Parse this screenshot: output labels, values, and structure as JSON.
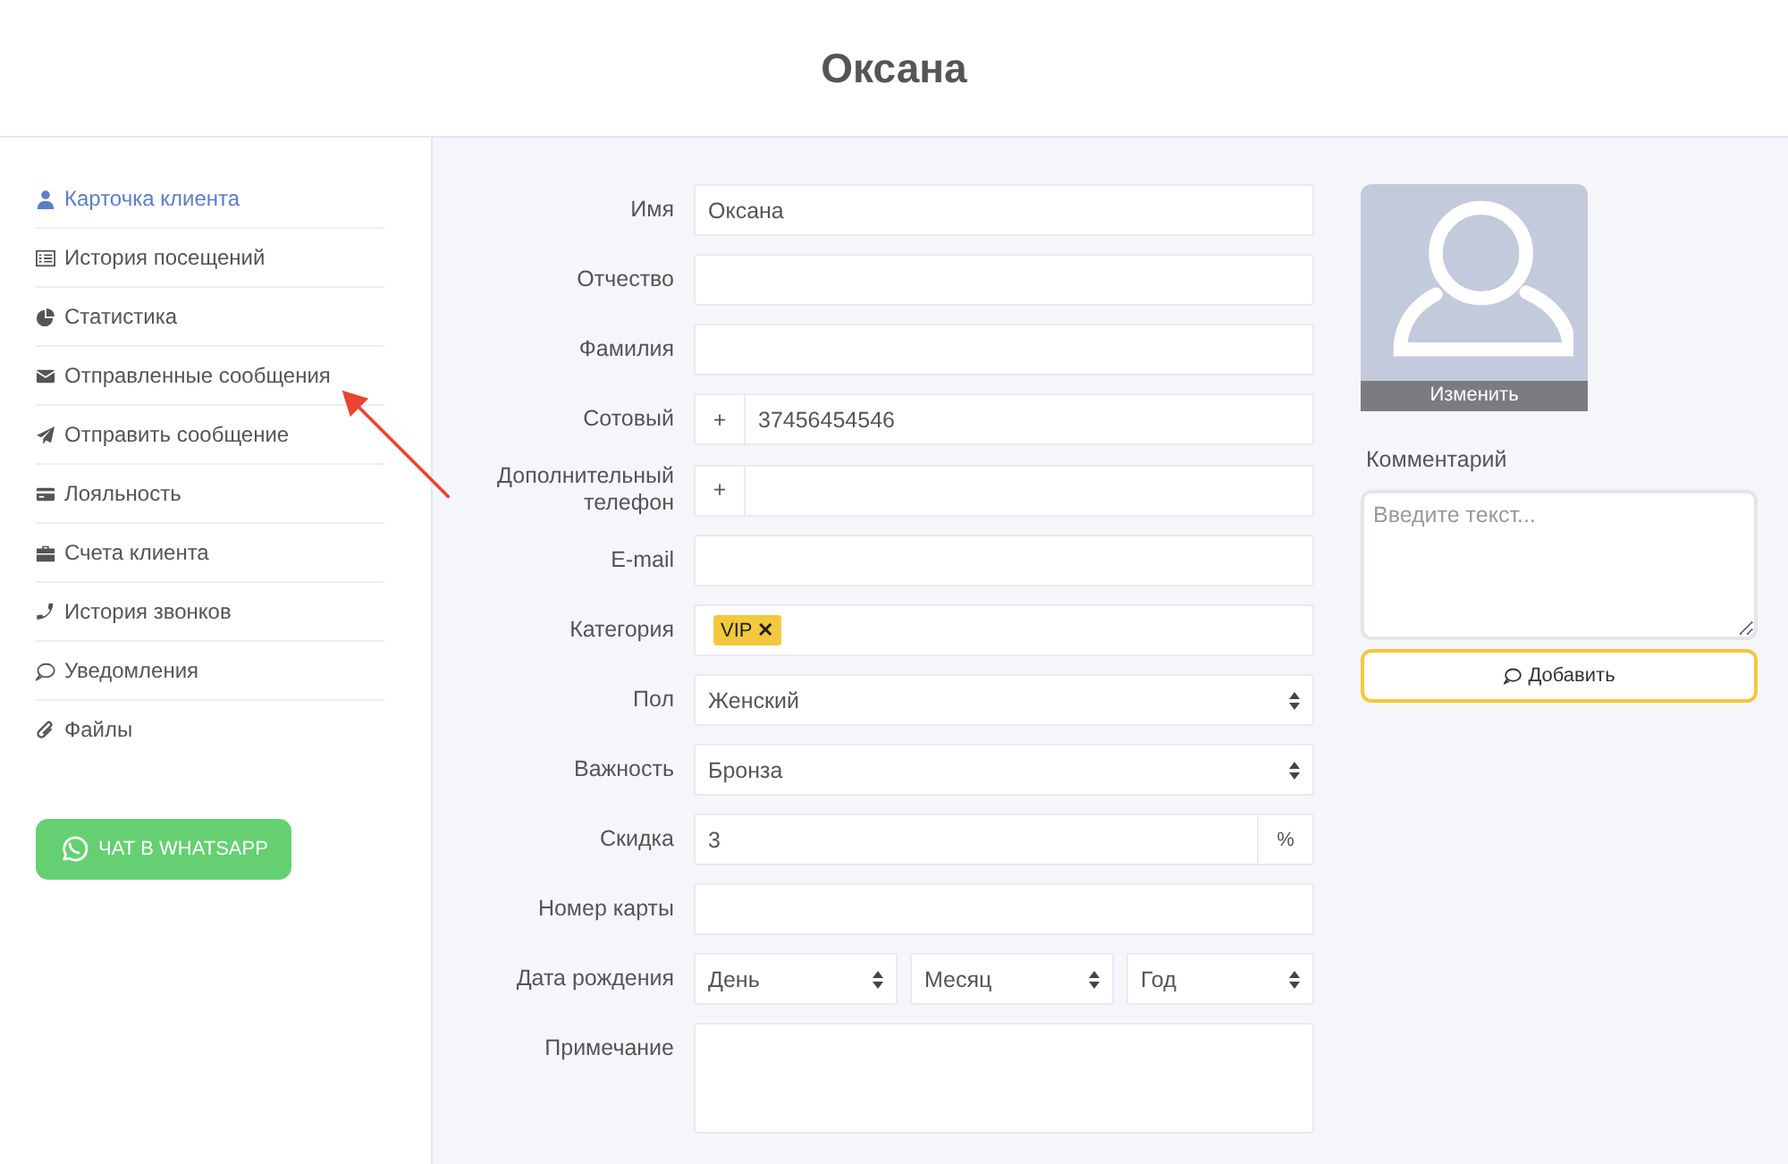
{
  "header": {
    "title": "Оксана"
  },
  "sidebar": {
    "items": [
      {
        "label": "Карточка клиента",
        "selected": true
      },
      {
        "label": "История посещений",
        "selected": false
      },
      {
        "label": "Статистика",
        "selected": false
      },
      {
        "label": "Отправленные сообщения",
        "selected": false
      },
      {
        "label": "Отправить сообщение",
        "selected": false
      },
      {
        "label": "Лояльность",
        "selected": false
      },
      {
        "label": "Счета клиента",
        "selected": false
      },
      {
        "label": "История звонков",
        "selected": false
      },
      {
        "label": "Уведомления",
        "selected": false
      },
      {
        "label": "Файлы",
        "selected": false
      }
    ],
    "whatsapp_button": "ЧАТ В WHATSAPP"
  },
  "form": {
    "fields": [
      {
        "kind": "text",
        "label": "Имя",
        "value": "Оксана"
      },
      {
        "kind": "text",
        "label": "Отчество"
      },
      {
        "kind": "text",
        "label": "Фамилия"
      },
      {
        "kind": "phone",
        "label": "Сотовый",
        "prefix": "+",
        "value": "37456454546"
      },
      {
        "kind": "phone",
        "label": "Дополнительный телефон",
        "prefix": "+"
      },
      {
        "kind": "text",
        "label": "E-mail"
      },
      {
        "kind": "tags",
        "label": "Категория",
        "tags": [
          "VIP"
        ],
        "remove": "✕"
      },
      {
        "kind": "select",
        "label": "Пол",
        "value": "Женский"
      },
      {
        "kind": "select",
        "label": "Важность",
        "value": "Бронза"
      },
      {
        "kind": "suffix",
        "label": "Скидка",
        "value": "3",
        "suffix": "%"
      },
      {
        "kind": "text",
        "label": "Номер карты"
      },
      {
        "kind": "date",
        "label": "Дата рождения",
        "parts": [
          "День",
          "Месяц",
          "Год"
        ]
      },
      {
        "kind": "textarea",
        "label": "Примечание"
      }
    ]
  },
  "avatar": {
    "change_label": "Изменить"
  },
  "comment": {
    "label": "Комментарий",
    "placeholder": "Введите текст...",
    "button": "Добавить"
  }
}
